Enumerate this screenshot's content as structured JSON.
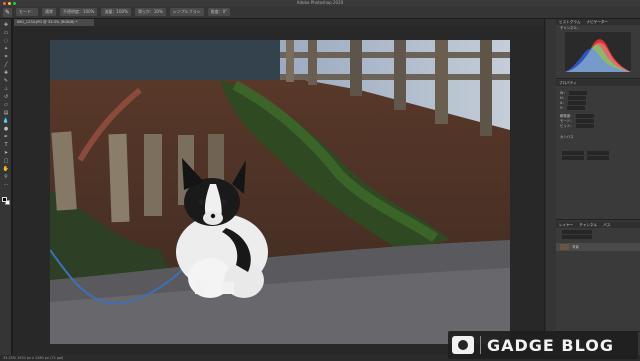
{
  "window": {
    "title": "Adobe Photoshop 2020"
  },
  "options_bar": {
    "tool_icon": "brush-icon",
    "items": [
      "モード：",
      "通常",
      "不透明度：100%",
      "流量：100%",
      "滑らか：10%",
      "シンプルブラシ",
      "角度：0°"
    ]
  },
  "document": {
    "tab_label": "IMG_1234.JPG @ 33.3% (RGB/8) *"
  },
  "toolbar": {
    "tools": [
      "move-icon",
      "marquee-icon",
      "lasso-icon",
      "quick-select-icon",
      "crop-icon",
      "eyedropper-icon",
      "healing-icon",
      "brush-icon",
      "stamp-icon",
      "history-brush-icon",
      "eraser-icon",
      "gradient-icon",
      "blur-icon",
      "dodge-icon",
      "pen-icon",
      "type-icon",
      "path-select-icon",
      "rectangle-icon",
      "hand-icon",
      "zoom-icon",
      "more-icon"
    ]
  },
  "panels": {
    "histogram": {
      "tabs": [
        "ヒストグラム",
        "ナビゲーター"
      ],
      "label": "チャンネル："
    },
    "properties": {
      "title": "プロパティ",
      "rows": [
        "W：",
        "H：",
        "X：",
        "Y：",
        "解像度：",
        "モード：",
        "ビット：",
        "カンバス"
      ]
    },
    "layers": {
      "tabs": [
        "レイヤー",
        "チャンネル",
        "パス"
      ],
      "layer_name": "背景"
    }
  },
  "status": {
    "text": "33.33%    1920 px x 1280 px (72 ppi)"
  },
  "watermark": {
    "text": "GADGE BLOG"
  },
  "colors": {
    "bg": "#1e1e1e",
    "panel": "#353535",
    "accent": "#4a8ad4"
  }
}
